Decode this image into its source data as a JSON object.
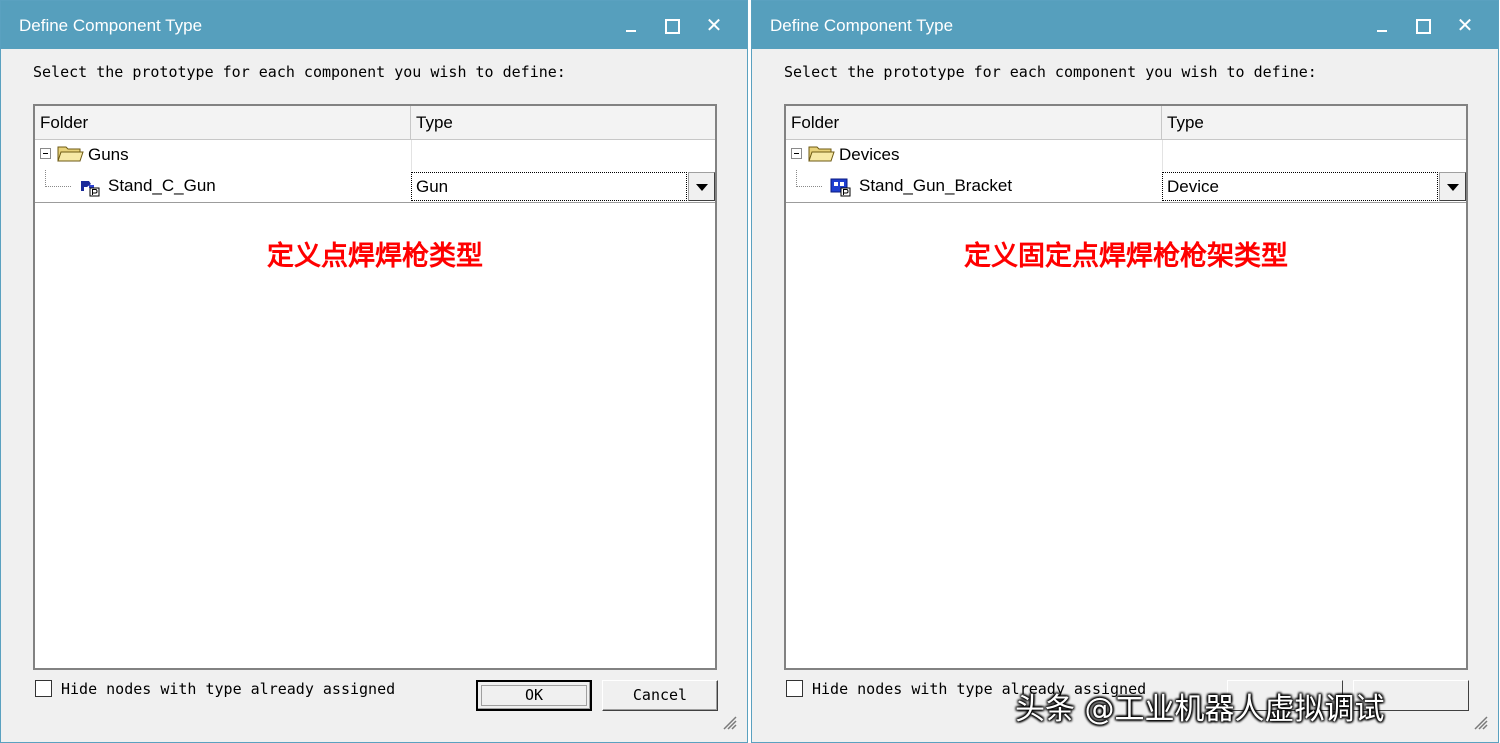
{
  "dialogs": [
    {
      "title": "Define Component Type",
      "instruction": "Select the prototype for each component you wish to define:",
      "columns": {
        "folder": "Folder",
        "type": "Type"
      },
      "folder_node": {
        "label": "Guns",
        "icon": "folder-open-icon"
      },
      "component_node": {
        "label": "Stand_C_Gun",
        "icon": "gun-component-icon",
        "type_value": "Gun"
      },
      "annotation": "定义点焊焊枪类型",
      "hide_nodes_label": "Hide nodes with type already assigned",
      "ok_label": "OK",
      "cancel_label": "Cancel"
    },
    {
      "title": "Define Component Type",
      "instruction": "Select the prototype for each component you wish to define:",
      "columns": {
        "folder": "Folder",
        "type": "Type"
      },
      "folder_node": {
        "label": "Devices",
        "icon": "folder-open-icon"
      },
      "component_node": {
        "label": "Stand_Gun_Bracket",
        "icon": "device-component-icon",
        "type_value": "Device"
      },
      "annotation": "定义固定点焊焊枪枪架类型",
      "hide_nodes_label": "Hide nodes with type already assigned"
    }
  ],
  "watermark": "头条 @工业机器人虚拟调试",
  "colors": {
    "titlebar": "#569fbd",
    "annotation": "#ff0000",
    "dialog_bg": "#f0f0f0"
  }
}
